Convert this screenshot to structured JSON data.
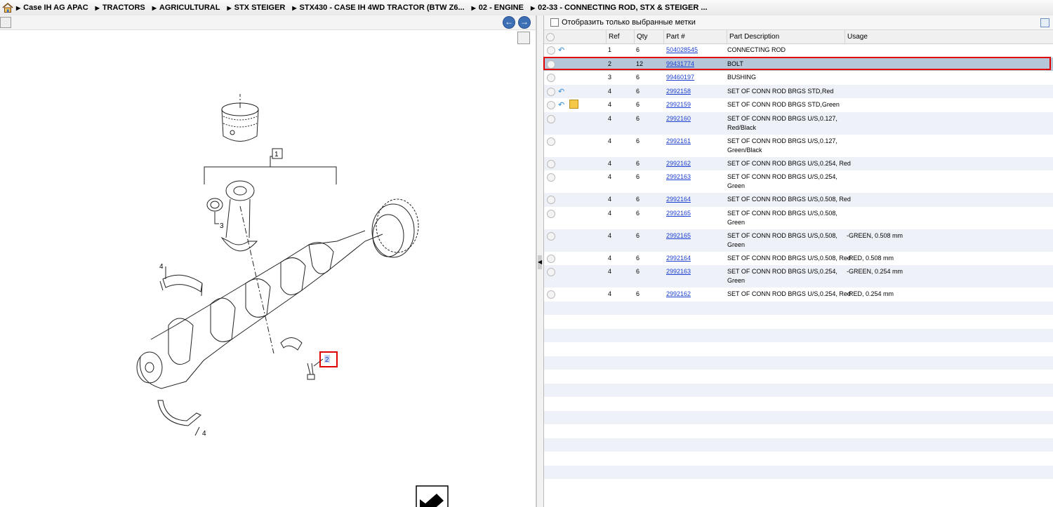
{
  "breadcrumb": [
    "Case IH AG APAC",
    "TRACTORS",
    "AGRICULTURAL",
    "STX STEIGER",
    "STX430 - CASE IH 4WD TRACTOR (BTW Z6...",
    "02 - ENGINE",
    "02-33 - CONNECTING ROD, STX & STEIGER ..."
  ],
  "filter": {
    "label": "Отобразить только выбранные метки"
  },
  "columns": {
    "ref": "Ref",
    "qty": "Qty",
    "part": "Part #",
    "desc": "Part Description",
    "usage": "Usage"
  },
  "drawing": {
    "callouts": {
      "one": "1",
      "two": "2",
      "three": "3",
      "four_a": "4",
      "four_b": "4"
    }
  },
  "rows": [
    {
      "ref": "1",
      "qty": "6",
      "part": "504028545",
      "desc": "CONNECTING ROD",
      "desc2": "",
      "usage": "",
      "icons": [
        "back"
      ]
    },
    {
      "ref": "2",
      "qty": "12",
      "part": "99431774",
      "desc": "BOLT",
      "desc2": "",
      "usage": "",
      "icons": [],
      "selected": true
    },
    {
      "ref": "3",
      "qty": "6",
      "part": "99460197",
      "desc": "BUSHING",
      "desc2": "",
      "usage": "",
      "icons": []
    },
    {
      "ref": "4",
      "qty": "6",
      "part": "2992158",
      "desc": "SET OF CONN ROD BRGS STD,Red",
      "desc2": "",
      "usage": "",
      "icons": [
        "back"
      ]
    },
    {
      "ref": "4",
      "qty": "6",
      "part": "2992159",
      "desc": "SET OF CONN ROD BRGS STD,Green",
      "desc2": "",
      "usage": "",
      "icons": [
        "back",
        "box"
      ]
    },
    {
      "ref": "4",
      "qty": "6",
      "part": "2992160",
      "desc": "SET OF CONN ROD BRGS U/S,0.127,",
      "desc2": "Red/Black",
      "usage": "",
      "icons": []
    },
    {
      "ref": "4",
      "qty": "6",
      "part": "2992161",
      "desc": "SET OF CONN ROD BRGS U/S,0.127,",
      "desc2": "Green/Black",
      "usage": "",
      "icons": []
    },
    {
      "ref": "4",
      "qty": "6",
      "part": "2992162",
      "desc": "SET OF CONN ROD BRGS U/S,0.254, Red",
      "desc2": "",
      "usage": "",
      "icons": []
    },
    {
      "ref": "4",
      "qty": "6",
      "part": "2992163",
      "desc": "SET OF CONN ROD BRGS U/S,0.254,",
      "desc2": "Green",
      "usage": "",
      "icons": []
    },
    {
      "ref": "4",
      "qty": "6",
      "part": "2992164",
      "desc": "SET OF CONN ROD BRGS U/S,0.508, Red",
      "desc2": "",
      "usage": "",
      "icons": []
    },
    {
      "ref": "4",
      "qty": "6",
      "part": "2992165",
      "desc": "SET OF CONN ROD BRGS U/S,0.508,",
      "desc2": "Green",
      "usage": "",
      "icons": []
    },
    {
      "ref": "4",
      "qty": "6",
      "part": "2992165",
      "desc": "SET OF CONN ROD BRGS U/S,0.508,",
      "desc2": "Green",
      "usage": "-GREEN, 0.508 mm",
      "icons": []
    },
    {
      "ref": "4",
      "qty": "6",
      "part": "2992164",
      "desc": "SET OF CONN ROD BRGS U/S,0.508, Red",
      "desc2": "",
      "usage": "-RED, 0.508 mm",
      "icons": []
    },
    {
      "ref": "4",
      "qty": "6",
      "part": "2992163",
      "desc": "SET OF CONN ROD BRGS U/S,0.254,",
      "desc2": "Green",
      "usage": "-GREEN, 0.254 mm",
      "icons": []
    },
    {
      "ref": "4",
      "qty": "6",
      "part": "2992162",
      "desc": "SET OF CONN ROD BRGS U/S,0.254, Red",
      "desc2": "",
      "usage": "-RED, 0.254 mm",
      "icons": []
    }
  ],
  "colors": {
    "selected_row": "#b6c6d9",
    "highlight": "#e00000",
    "link": "#1a3ed0"
  }
}
